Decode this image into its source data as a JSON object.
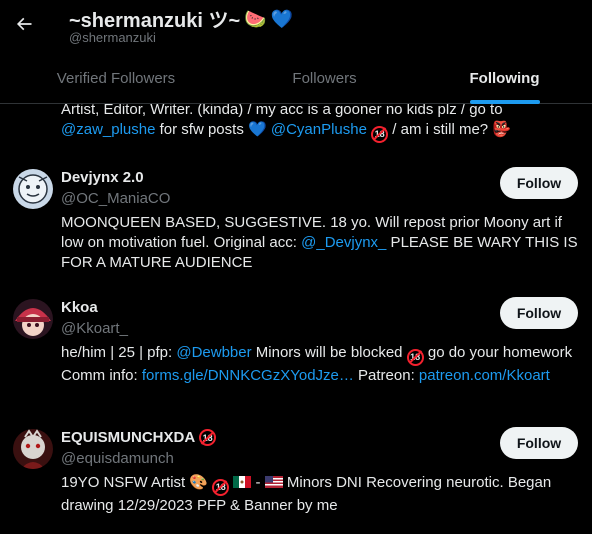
{
  "header": {
    "title": "~shermanzuki ツ~",
    "title_emojis": [
      "🍉",
      "💙"
    ],
    "handle": "@shermanzuki",
    "back_icon": "arrow-left-icon"
  },
  "tabs": [
    {
      "label": "Verified Followers",
      "active": false
    },
    {
      "label": "Followers",
      "active": false
    },
    {
      "label": "Following",
      "active": true
    }
  ],
  "colors": {
    "accent": "#1d9bf0",
    "background": "#000000",
    "text": "#e7e9ea",
    "muted": "#71767b",
    "follow_bg": "#eff3f4"
  },
  "partial_user": {
    "bio_line1": "Artist, Editor, Writer. (kinda) / my acc is a gooner no kids plz / go to",
    "bio_link1": "@zaw_plushe",
    "bio_text2": " for sfw posts ",
    "bio_heart": "💙",
    "bio_link2": "@CyanPlushe",
    "bio_badge": "18",
    "bio_text3": " / am i still me? ",
    "bio_emoji": "👺"
  },
  "users": [
    {
      "name": "Devjynx 2.0",
      "handle": "@OC_ManiaCO",
      "follow_label": "Follow",
      "bio_text1": "MOONQUEEN BASED, SUGGESTIVE. 18 yo. Will repost prior Moony art if low on motivation fuel. Original acc: ",
      "bio_link1": "@_Devjynx_",
      "bio_text2": " PLEASE BE WARY THIS IS FOR A MATURE AUDIENCE"
    },
    {
      "name": "Kkoa",
      "handle": "@Kkoart_",
      "follow_label": "Follow",
      "bio_text1": "he/him | 25 | pfp: ",
      "bio_link1": "@Dewbber",
      "bio_text2": " Minors will be blocked ",
      "bio_badge": "18",
      "bio_text3": " go do your homework Comm info: ",
      "bio_link2": "forms.gle/DNNKCGzXYodJze…",
      "bio_text4": " Patreon: ",
      "bio_link3": "patreon.com/Kkoart"
    },
    {
      "name": "EQUISMUNCHXDA",
      "name_badge": "18",
      "handle": "@equisdamunch",
      "follow_label": "Follow",
      "bio_text1": "19YO NSFW Artist ",
      "bio_emoji1": "🎨",
      "bio_badge": "18",
      "bio_text2": " - ",
      "bio_text3": " Minors DNI Recovering neurotic. Began drawing 12/29/2023 PFP & Banner by me"
    }
  ]
}
